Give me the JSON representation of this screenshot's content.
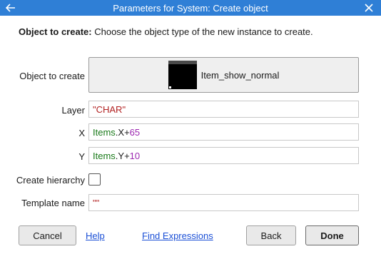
{
  "window": {
    "title": "Parameters for System: Create object",
    "back_icon": "arrow-left-icon",
    "close_icon": "close-icon"
  },
  "description": {
    "label": "Object to create:",
    "text": "Choose the object type of the new instance to create."
  },
  "object_to_create": {
    "label": "Object to create",
    "name": "Item_show_normal"
  },
  "layer": {
    "label": "Layer",
    "value": "\"CHAR\""
  },
  "x": {
    "label": "X",
    "object": "Items",
    "expr": ".X+",
    "number": "65"
  },
  "y": {
    "label": "Y",
    "object": "Items",
    "expr": ".Y+",
    "number": "10"
  },
  "create_hierarchy": {
    "label": "Create hierarchy",
    "checked": false
  },
  "template_name": {
    "label": "Template name",
    "value": "\"\""
  },
  "buttons": {
    "cancel": "Cancel",
    "help": "Help",
    "find_expressions": "Find Expressions",
    "back": "Back",
    "done": "Done"
  },
  "colors": {
    "titlebar": "#2f7fd6",
    "string_literal": "#b22222",
    "object_name": "#1a7a1a",
    "number": "#9c27b0",
    "link": "#1a4fd6"
  }
}
